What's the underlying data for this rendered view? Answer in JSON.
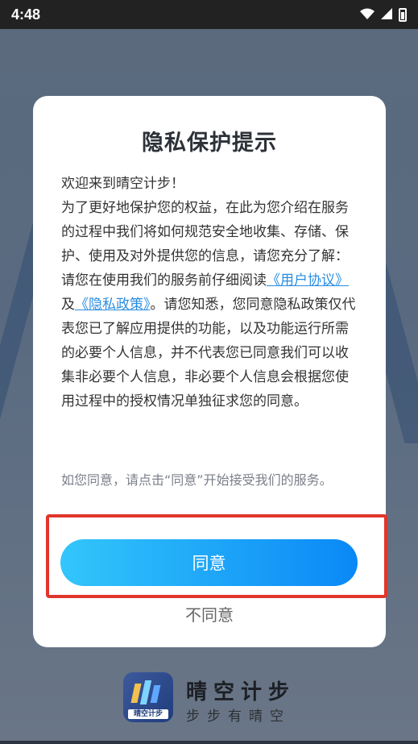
{
  "status_bar": {
    "time": "4:48",
    "icons": [
      "wifi-icon",
      "signal-icon",
      "battery-icon"
    ]
  },
  "dialog": {
    "title": "隐私保护提示",
    "body": {
      "welcome": "欢迎来到晴空计步！",
      "intro": "为了更好地保护您的权益，在此为您介绍在服务的过程中我们将如何规范安全地收集、存储、保护、使用及对外提供您的信息，请您充分了解：",
      "read_prefix": "请您在使用我们的服务前仔细阅读",
      "user_agreement_link": "《用户协议》",
      "and": "及",
      "privacy_policy_link": "《隐私政策》",
      "read_suffix": "。请您知悉，您同意隐私政策仅代表您已了解应用提供的功能，以及功能运行所需的必要个人信息，并不代表您已同意我们可以收集非必要个人信息，非必要个人信息会根据您使用过程中的授权情况单独征求您的同意。"
    },
    "hint": "如您同意，请点击“同意”开始接受我们的服务。",
    "agree_label": "同意",
    "disagree_label": "不同意"
  },
  "brand": {
    "logo_text": "晴空计步",
    "name": "晴空计步",
    "slogan": "步步有晴空"
  },
  "colors": {
    "link": "#2a8de0",
    "button_gradient_start": "#33c6fb",
    "button_gradient_end": "#0a88f6",
    "highlight": "#e0352b"
  }
}
